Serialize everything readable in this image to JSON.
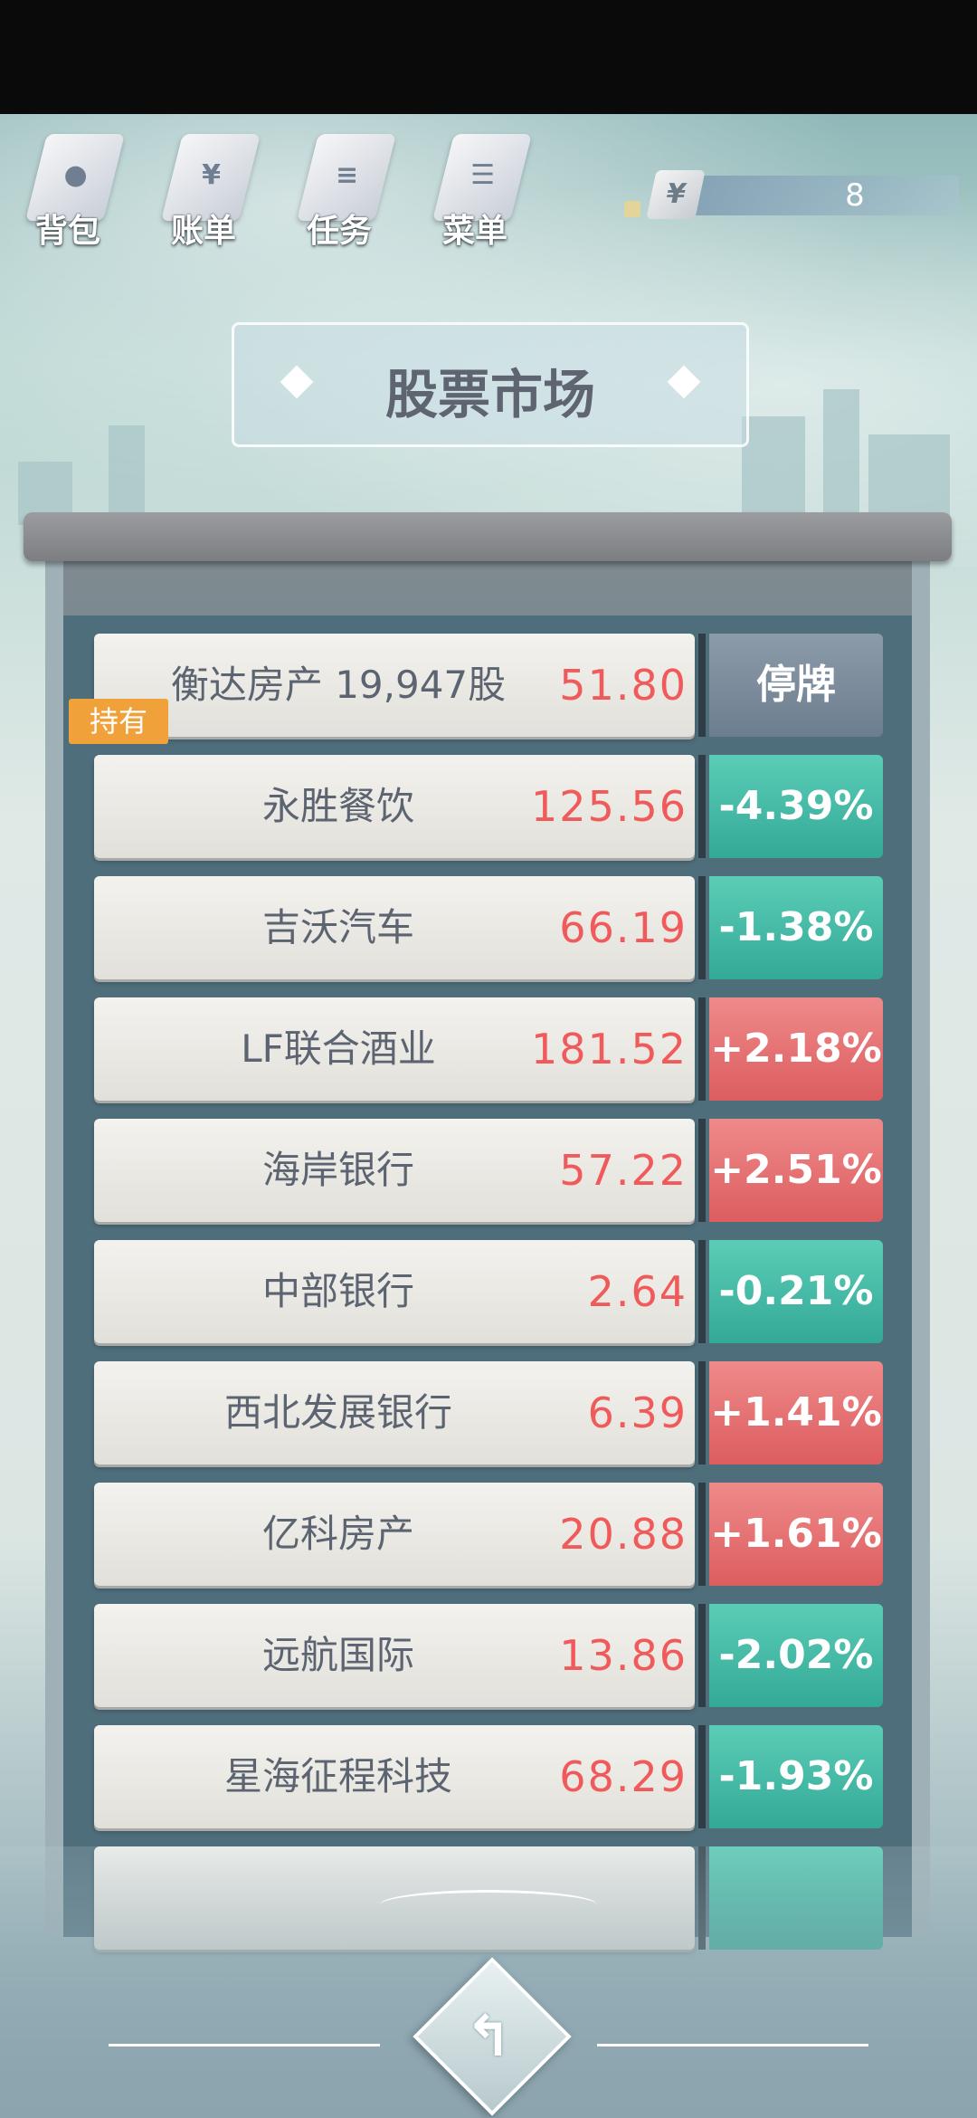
{
  "nav": {
    "items": [
      {
        "label": "背包",
        "icon": "bag-icon",
        "mark": "●"
      },
      {
        "label": "账单",
        "icon": "bill-icon",
        "mark": "¥"
      },
      {
        "label": "任务",
        "icon": "task-icon",
        "mark": "≡"
      },
      {
        "label": "菜单",
        "icon": "menu-icon",
        "mark": "☰"
      }
    ]
  },
  "money": {
    "symbol": "¥",
    "value": "8"
  },
  "title": "股票市场",
  "held_tag": "持有",
  "stocks": [
    {
      "name": "衡达房产  19,947股",
      "price": "51.80",
      "change": "停牌",
      "trend": "halt"
    },
    {
      "name": "永胜餐饮",
      "price": "125.56",
      "change": "-4.39%",
      "trend": "down"
    },
    {
      "name": "吉沃汽车",
      "price": "66.19",
      "change": "-1.38%",
      "trend": "down"
    },
    {
      "name": "LF联合酒业",
      "price": "181.52",
      "change": "+2.18%",
      "trend": "up"
    },
    {
      "name": "海岸银行",
      "price": "57.22",
      "change": "+2.51%",
      "trend": "up"
    },
    {
      "name": "中部银行",
      "price": "2.64",
      "change": "-0.21%",
      "trend": "down"
    },
    {
      "name": "西北发展银行",
      "price": "6.39",
      "change": "+1.41%",
      "trend": "up"
    },
    {
      "name": "亿科房产",
      "price": "20.88",
      "change": "+1.61%",
      "trend": "up"
    },
    {
      "name": "远航国际",
      "price": "13.86",
      "change": "-2.02%",
      "trend": "down"
    },
    {
      "name": "星海征程科技",
      "price": "68.29",
      "change": "-1.93%",
      "trend": "down"
    },
    {
      "name": "",
      "price": "",
      "change": "",
      "trend": "down"
    }
  ],
  "back": {
    "symbol": "↰"
  },
  "colors": {
    "up": "#dc5d5f",
    "down": "#33a997",
    "halt": "#6c7d8f",
    "price": "#f05a5a",
    "held": "#f0a13a"
  }
}
